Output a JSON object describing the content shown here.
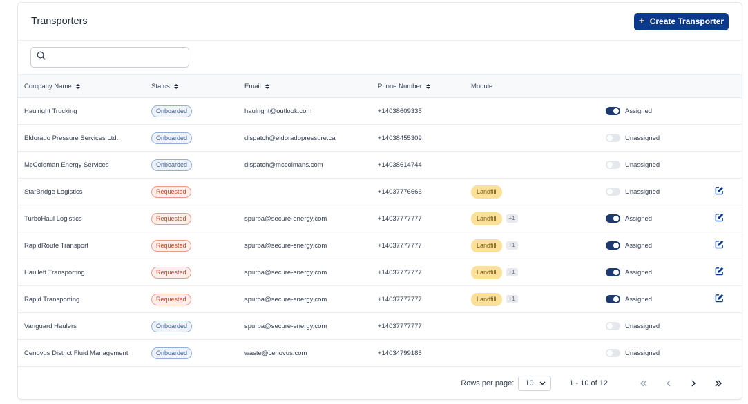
{
  "header": {
    "title": "Transporters",
    "create_label": "Create Transporter"
  },
  "search": {
    "placeholder": "",
    "value": ""
  },
  "columns": {
    "company": "Company Name",
    "status": "Status",
    "email": "Email",
    "phone": "Phone Number",
    "module": "Module"
  },
  "rows": [
    {
      "company": "Haulright Trucking",
      "status": "Onboarded",
      "email": "haulright@outlook.com",
      "phone": "+14038609335",
      "module": "",
      "extra": "",
      "assigned": true,
      "assign_label": "Assigned",
      "editable": false
    },
    {
      "company": "Eldorado Pressure Services Ltd.",
      "status": "Onboarded",
      "email": "dispatch@eldoradopressure.ca",
      "phone": "+14038455309",
      "module": "",
      "extra": "",
      "assigned": false,
      "assign_label": "Unassigned",
      "editable": false
    },
    {
      "company": "McColeman Energy Services",
      "status": "Onboarded",
      "email": "dispatch@mccolmans.com",
      "phone": "+14038614744",
      "module": "",
      "extra": "",
      "assigned": false,
      "assign_label": "Unassigned",
      "editable": false
    },
    {
      "company": "StarBridge Logistics",
      "status": "Requested",
      "email": "",
      "phone": "+14037776666",
      "module": "Landfill",
      "extra": "",
      "assigned": false,
      "assign_label": "Unassigned",
      "editable": true
    },
    {
      "company": "TurboHaul Logistics",
      "status": "Requested",
      "email": "spurba@secure-energy.com",
      "phone": "+14037777777",
      "module": "Landfill",
      "extra": "+1",
      "assigned": true,
      "assign_label": "Assigned",
      "editable": true
    },
    {
      "company": "RapidRoute Transport",
      "status": "Requested",
      "email": "spurba@secure-energy.com",
      "phone": "+14037777777",
      "module": "Landfill",
      "extra": "+1",
      "assigned": true,
      "assign_label": "Assigned",
      "editable": true
    },
    {
      "company": "Haulleft Transporting",
      "status": "Requested",
      "email": "spurba@secure-energy.com",
      "phone": "+14037777777",
      "module": "Landfill",
      "extra": "+1",
      "assigned": true,
      "assign_label": "Assigned",
      "editable": true
    },
    {
      "company": "Rapid Transporting",
      "status": "Requested",
      "email": "spurba@secure-energy.com",
      "phone": "+14037777777",
      "module": "Landfill",
      "extra": "+1",
      "assigned": true,
      "assign_label": "Assigned",
      "editable": true
    },
    {
      "company": "Vanguard Haulers",
      "status": "Onboarded",
      "email": "spurba@secure-energy.com",
      "phone": "+14037777777",
      "module": "",
      "extra": "",
      "assigned": false,
      "assign_label": "Unassigned",
      "editable": false
    },
    {
      "company": "Cenovus District Fluid Management",
      "status": "Onboarded",
      "email": "waste@cenovus.com",
      "phone": "+14034799185",
      "module": "",
      "extra": "",
      "assigned": false,
      "assign_label": "Unassigned",
      "editable": false
    }
  ],
  "pagination": {
    "rows_label": "Rows per page:",
    "rows_value": "10",
    "range": "1 - 10 of 12"
  },
  "colors": {
    "primary": "#0b3a8c",
    "toggle_on": "#1e3a6e",
    "onboarded": "#3c5f98",
    "requested": "#c0492f",
    "module": "#fbe09a"
  }
}
